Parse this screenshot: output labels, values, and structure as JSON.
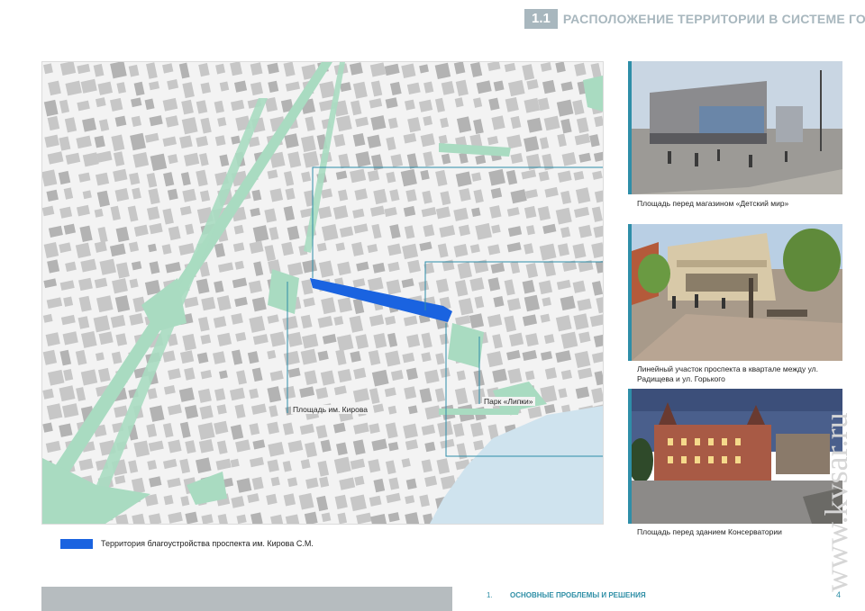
{
  "header": {
    "section_number": "1.1",
    "section_title": "РАСПОЛОЖЕНИЕ ТЕРРИТОРИИ В СИСТЕМЕ ГОРОДА"
  },
  "map": {
    "label_kirov_square": "Площадь им. Кирова",
    "label_lipki_park": "Парк «Липки»",
    "colors": {
      "street_highlight": "#1a63e0",
      "callout_line": "#2e8ea8",
      "green_area": "#a9dbc1",
      "water": "#cfe3ee",
      "blocks": "#c7c7c7"
    }
  },
  "photos": [
    {
      "caption": "Площадь перед магазином «Детский мир»"
    },
    {
      "caption": "Линейный участок проспекта в квартале между ул. Радищева и ул. Горького"
    },
    {
      "caption": "Площадь перед зданием Консерватории"
    }
  ],
  "legend": {
    "label": "Территория благоустройства проспекта им. Кирова С.М.",
    "color": "#1a63e0"
  },
  "footer": {
    "number": "1.",
    "title": "ОСНОВНЫЕ ПРОБЛЕМЫ И РЕШЕНИЯ",
    "page": "4"
  },
  "watermark": "www.kvsar.ru"
}
